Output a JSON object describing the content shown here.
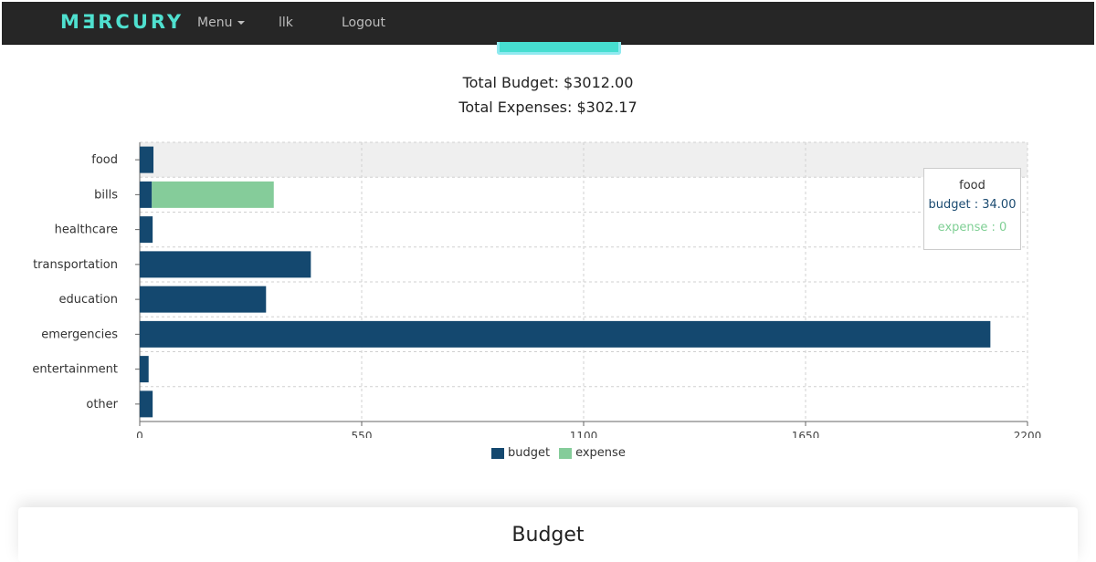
{
  "navbar": {
    "brand": "MƎRCURY",
    "menu_label": "Menu",
    "user_label": "llk",
    "logout_label": "Logout"
  },
  "totals": {
    "budget_text": "Total Budget: $3012.00",
    "expenses_text": "Total Expenses: $302.17"
  },
  "colors": {
    "budget": "#14486f",
    "expense": "#85cc9a",
    "brand": "#4fe0cf",
    "highlight_row": "#efefef"
  },
  "chart_data": {
    "type": "bar",
    "orientation": "horizontal",
    "categories": [
      "food",
      "bills",
      "healthcare",
      "transportation",
      "education",
      "emergencies",
      "entertainment",
      "other"
    ],
    "series": [
      {
        "name": "budget",
        "values": [
          34,
          30,
          32,
          424,
          313,
          2108,
          22,
          32
        ]
      },
      {
        "name": "expense",
        "values": [
          0,
          302.17,
          0,
          0,
          0,
          0,
          0,
          0
        ]
      }
    ],
    "stacked": true,
    "xlim": [
      0,
      2200
    ],
    "xticks": [
      "0",
      "550",
      "1100",
      "1650",
      "2200"
    ],
    "grid": true,
    "legend_position": "bottom",
    "highlighted_category": "food"
  },
  "legend": {
    "budget_label": "budget",
    "expense_label": "expense"
  },
  "tooltip": {
    "title": "food",
    "budget_line": "budget : 34.00",
    "expense_line": "expense : 0"
  },
  "section": {
    "title": "Budget"
  }
}
